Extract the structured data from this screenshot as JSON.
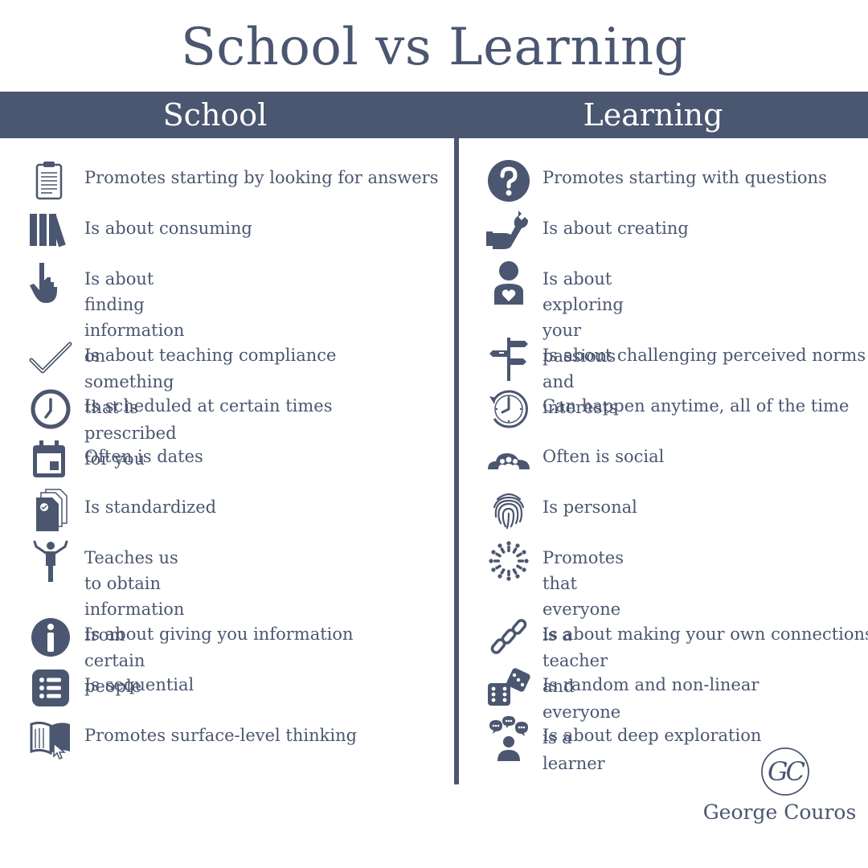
{
  "title": "School vs Learning",
  "columns": {
    "school": "School",
    "learning": "Learning"
  },
  "school_items": [
    {
      "text": "Promotes starting by looking for answers",
      "icon": "clipboard-icon"
    },
    {
      "text": "Is about consuming",
      "icon": "books-icon"
    },
    {
      "text": "Is about finding information on something\nthat is prescribed for you",
      "icon": "pointing-hand-icon"
    },
    {
      "text": "Is about teaching compliance",
      "icon": "checkmark-icon"
    },
    {
      "text": "Is scheduled at certain times",
      "icon": "clock-icon"
    },
    {
      "text": "Often is dates",
      "icon": "calendar-icon"
    },
    {
      "text": "Is standardized",
      "icon": "documents-icon"
    },
    {
      "text": "Teaches us to obtain information from\ncertain people",
      "icon": "person-pointing-icon"
    },
    {
      "text": "Is about giving you information",
      "icon": "info-icon"
    },
    {
      "text": "Is sequential",
      "icon": "list-icon"
    },
    {
      "text": "Promotes surface-level thinking",
      "icon": "open-book-icon"
    }
  ],
  "learning_items": [
    {
      "text": "Promotes starting with questions",
      "icon": "question-icon"
    },
    {
      "text": "Is about creating",
      "icon": "hand-wrench-icon"
    },
    {
      "text": "Is about exploring your passions and\ninterests",
      "icon": "person-heart-icon"
    },
    {
      "text": "Is about challenging perceived norms",
      "icon": "signpost-icon"
    },
    {
      "text": "Can happen anytime, all of the time",
      "icon": "clock-refresh-icon"
    },
    {
      "text": "Often is social",
      "icon": "people-cloud-icon"
    },
    {
      "text": "Is personal",
      "icon": "fingerprint-icon"
    },
    {
      "text": "Promotes that everyone is a teacher and\neveryone is a learner",
      "icon": "people-circle-icon"
    },
    {
      "text": "Is about making your own connections",
      "icon": "chain-link-icon"
    },
    {
      "text": "Is random and non-linear",
      "icon": "dice-icon"
    },
    {
      "text": "Is about deep exploration",
      "icon": "thinking-person-icon"
    }
  ],
  "logo": {
    "monogram": "GC",
    "name": "George Couros"
  },
  "colors": {
    "primary": "#4b5670",
    "background": "#ffffff"
  }
}
